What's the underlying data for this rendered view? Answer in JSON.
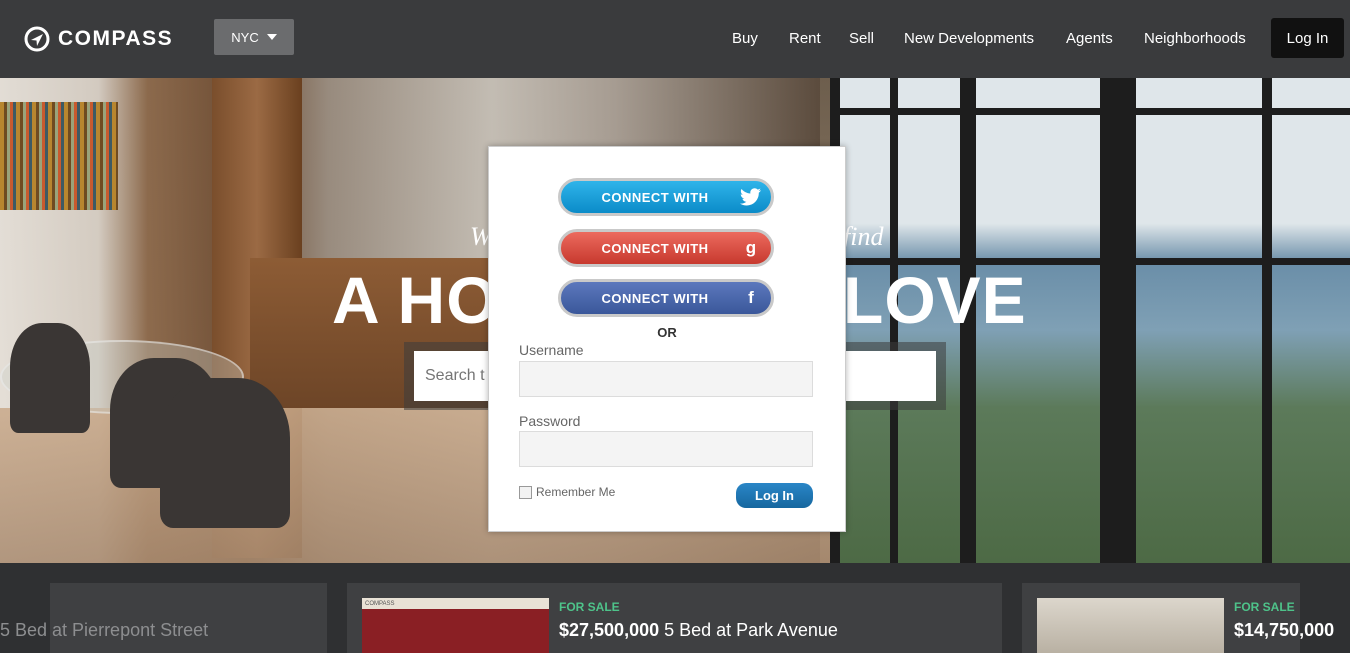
{
  "header": {
    "logo_text": "COMPASS",
    "city": "NYC",
    "nav": [
      "Buy",
      "Rent",
      "Sell",
      "New Developments",
      "Agents",
      "Neighborhoods"
    ],
    "login_label": "Log In"
  },
  "hero": {
    "tagline_left": "W",
    "tagline_right": "find",
    "headline_left": "A HO",
    "headline_right": "LOVE",
    "search_placeholder": "Search t"
  },
  "login_modal": {
    "twitter_label": "CONNECT WITH",
    "google_label": "CONNECT WITH",
    "facebook_label": "CONNECT WITH",
    "google_glyph": "g",
    "facebook_glyph": "f",
    "or_text": "OR",
    "username_label": "Username",
    "password_label": "Password",
    "remember_label": "Remember Me",
    "submit_label": "Log In"
  },
  "listings": [
    {
      "address": "5 Bed at Pierrepont Street"
    },
    {
      "status": "FOR SALE",
      "price": "$27,500,000",
      "description": " 5 Bed at Park Avenue",
      "brand": "COMPASS"
    },
    {
      "status": "FOR SALE",
      "price": "$14,750,000"
    }
  ],
  "colors": {
    "accent_green": "#4ec38a",
    "nav_bg": "#3a3b3d",
    "twitter": "#0b8bc8",
    "google": "#c7392e",
    "facebook": "#3a579a"
  }
}
